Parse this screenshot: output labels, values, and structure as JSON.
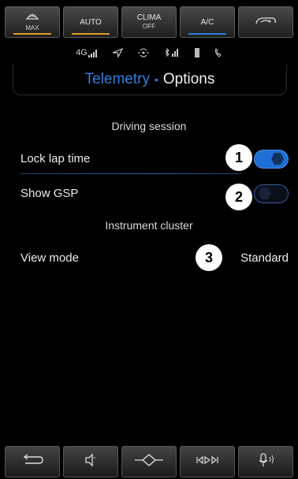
{
  "climate": {
    "buttons": [
      {
        "icon": "defrost-max-icon",
        "label": "MAX",
        "indicator_color": "#e0a020"
      },
      {
        "label": "AUTO",
        "indicator_color": "#e0a020"
      },
      {
        "label": "CLIMA",
        "sub": "OFF"
      },
      {
        "label": "A/C",
        "indicator_color": "#2f7fe0"
      },
      {
        "icon": "air-recirculation-icon"
      }
    ]
  },
  "status": {
    "network": "4G"
  },
  "header": {
    "active_tab": "Telemetry",
    "separator": "•",
    "other_tab": "Options"
  },
  "sections": {
    "driving_session": "Driving session",
    "instrument_cluster": "Instrument cluster"
  },
  "settings": {
    "lock_lap_time": {
      "label": "Lock lap time",
      "badge": "1",
      "toggle": "on"
    },
    "show_gsp": {
      "label": "Show GSP",
      "badge": "2",
      "toggle": "off"
    },
    "view_mode": {
      "label": "View mode",
      "badge": "3",
      "value": "Standard"
    }
  },
  "bottom_bar": {
    "icons": [
      "back-arrow-icon",
      "speaker-icon",
      "home-diamond-icon",
      "media-controls-icon",
      "voice-microphone-icon"
    ]
  },
  "colors": {
    "accent": "#2f7fe0",
    "amber": "#e0a020",
    "background": "#000000"
  }
}
